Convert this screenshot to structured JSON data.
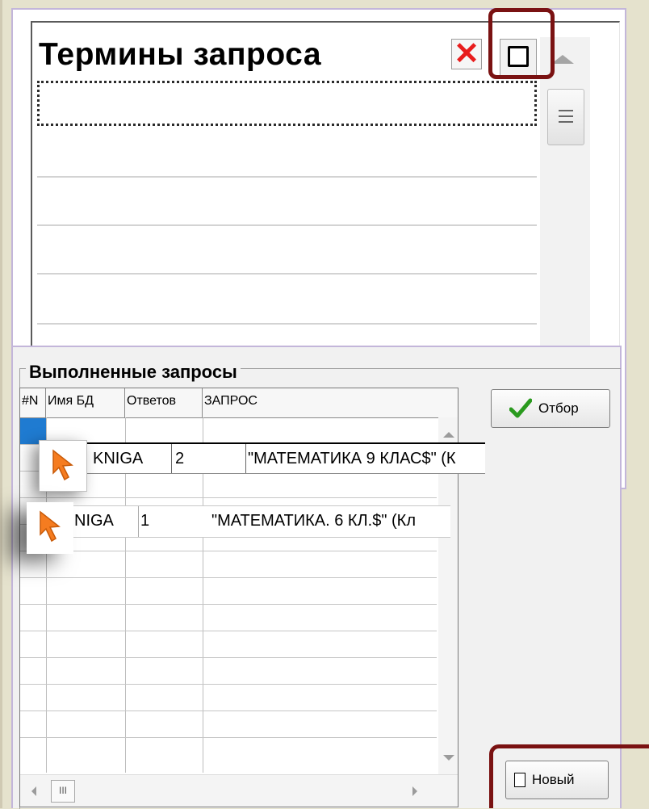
{
  "terms_panel": {
    "title": "Термины запроса",
    "clear_glyph": "✕",
    "clear_icon": "red-x-icon",
    "new_term_icon": "blank-document-icon"
  },
  "queries_panel": {
    "title": "Выполненные запросы",
    "columns": [
      "#N",
      "Имя БД",
      "Ответов",
      "ЗАПРОС"
    ],
    "rows": [
      {
        "db": "KNIGA",
        "answers": "2",
        "query": "\"МАТЕМАТИКА 9 КЛАС$\" (К"
      },
      {
        "db": "NIGA",
        "answers": "1",
        "query": "\"МАТЕМАТИКА. 6 КЛ.$\" (Кл"
      }
    ],
    "hscroll_thumb": "III"
  },
  "buttons": {
    "otbor_label": "Отбор",
    "otbor_icon": "green-checkmark-icon",
    "new_label": "Новый",
    "new_icon": "document-icon"
  },
  "colors": {
    "background": "#e5e2cd",
    "highlight": "#7a1212",
    "row_indicator": "#1f7bd1",
    "cursor": "#f57c20"
  }
}
